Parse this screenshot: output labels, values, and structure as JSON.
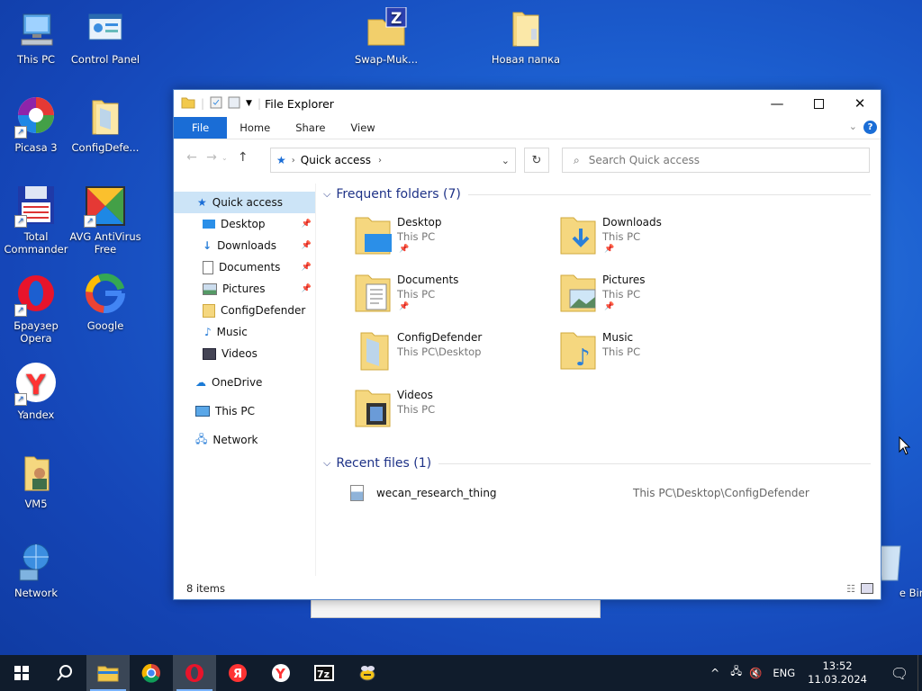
{
  "desktop": {
    "icons": [
      {
        "label": "This PC"
      },
      {
        "label": "Control Panel"
      },
      {
        "label": "Swap-Muk..."
      },
      {
        "label": "Новая папка"
      },
      {
        "label": "Picasa 3"
      },
      {
        "label": "ConfigDefe..."
      },
      {
        "label": "Total Commander"
      },
      {
        "label": "AVG AntiVirus Free"
      },
      {
        "label": "Браузер Opera"
      },
      {
        "label": "Google"
      },
      {
        "label": "Yandex"
      },
      {
        "label": "VM5"
      },
      {
        "label": "Network"
      },
      {
        "label": "e Bin"
      }
    ]
  },
  "window": {
    "title": "File Explorer",
    "ribbon_tabs": [
      "File",
      "Home",
      "Share",
      "View"
    ],
    "address": {
      "crumb": "Quick access"
    },
    "search": {
      "placeholder": "Search Quick access"
    },
    "sidebar": [
      {
        "label": "Quick access",
        "selected": true
      },
      {
        "label": "Desktop",
        "pinned": true
      },
      {
        "label": "Downloads",
        "pinned": true
      },
      {
        "label": "Documents",
        "pinned": true
      },
      {
        "label": "Pictures",
        "pinned": true
      },
      {
        "label": "ConfigDefender"
      },
      {
        "label": "Music"
      },
      {
        "label": "Videos"
      },
      {
        "label": "OneDrive"
      },
      {
        "label": "This PC"
      },
      {
        "label": "Network"
      }
    ],
    "frequent": {
      "header": "Frequent folders (7)",
      "items": [
        {
          "name": "Desktop",
          "path": "This PC",
          "pinned": true
        },
        {
          "name": "Downloads",
          "path": "This PC",
          "pinned": true
        },
        {
          "name": "Documents",
          "path": "This PC",
          "pinned": true
        },
        {
          "name": "Pictures",
          "path": "This PC",
          "pinned": true
        },
        {
          "name": "ConfigDefender",
          "path": "This PC\\Desktop"
        },
        {
          "name": "Music",
          "path": "This PC"
        },
        {
          "name": "Videos",
          "path": "This PC"
        }
      ]
    },
    "recent": {
      "header": "Recent files (1)",
      "items": [
        {
          "name": "wecan_research_thing",
          "path": "This PC\\Desktop\\ConfigDefender"
        }
      ]
    },
    "status": "8 items"
  },
  "taskbar": {
    "lang": "ENG",
    "time": "13:52",
    "date": "11.03.2024"
  },
  "colors": {
    "accent": "#1a6dd6",
    "header_text": "#1e3287",
    "selection": "#cce4f7"
  }
}
